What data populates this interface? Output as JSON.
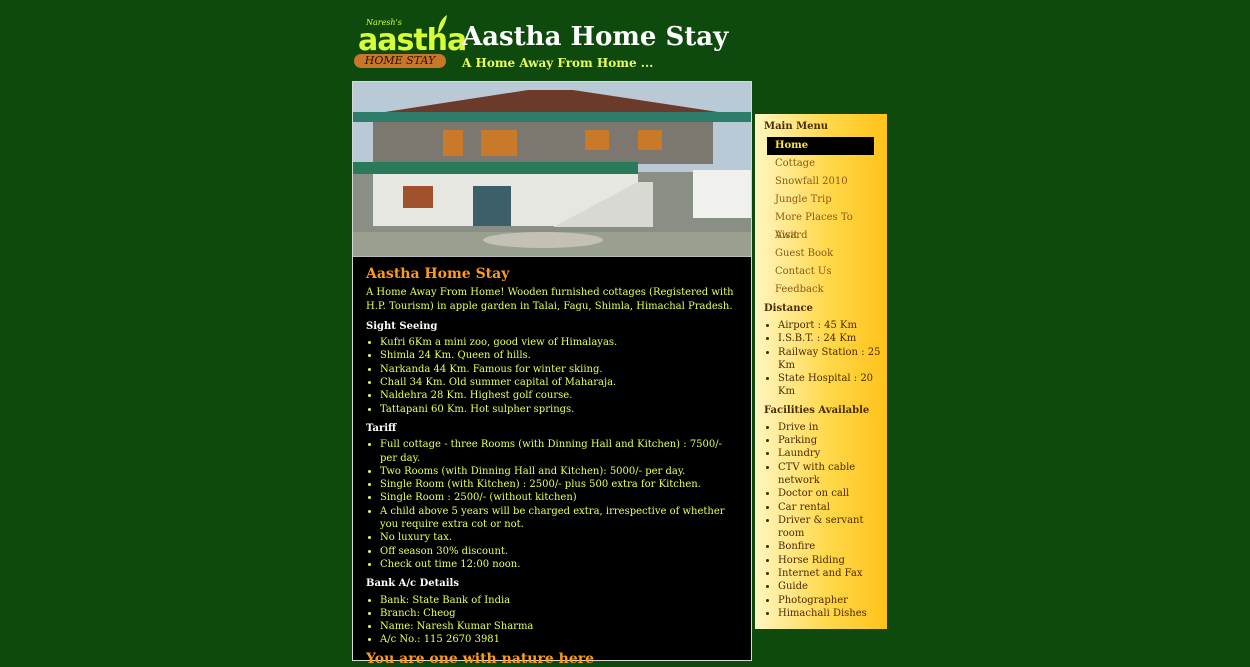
{
  "header": {
    "logo_small": "Naresh's",
    "logo_big": "aastha",
    "logo_band": "HOME STAY",
    "title": "Aastha Home Stay",
    "tagline": "A Home Away From Home ..."
  },
  "content": {
    "heading": "Aastha Home Stay",
    "intro": "A Home Away From Home! Wooden furnished cottages (Registered with H.P. Tourism) in apple garden in Talai, Fagu, Shimla, Himachal Pradesh.",
    "sight_title": "Sight Seeing",
    "sight": [
      "Kufri 6Km a mini zoo, good view of Himalayas.",
      "Shimla 24 Km. Queen of hills.",
      "Narkanda 44 Km. Famous for winter skiing.",
      "Chail 34 Km. Old summer capital of Maharaja.",
      "Naldehra 28 Km. Highest golf course.",
      "Tattapani 60 Km. Hot sulpher springs."
    ],
    "tariff_title": "Tariff",
    "tariff": [
      "Full cottage - three Rooms (with Dinning Hall and Kitchen) : 7500/- per day.",
      "Two Rooms (with Dinning Hall and Kitchen): 5000/- per day.",
      "Single Room (with Kitchen) : 2500/- plus 500 extra for Kitchen.",
      "Single Room : 2500/- (without kitchen)",
      "A child above 5 years will be charged extra, irrespective of whether you require extra cot or not.",
      "No luxury tax.",
      "Off season 30% discount.",
      "Check out time 12:00 noon."
    ],
    "bank_title": "Bank A/c Details",
    "bank": [
      "Bank: State Bank of India",
      "Branch: Cheog",
      "Name: Naresh Kumar Sharma",
      "A/c No.: 115 2670 3981"
    ],
    "closing": "You are one with nature here"
  },
  "sidebar": {
    "menu_title": "Main Menu",
    "menu": [
      "Home",
      "Cottage",
      "Snowfall 2010",
      "Jungle Trip",
      "More Places To Visit",
      "Award",
      "Guest Book",
      "Contact Us",
      "Feedback"
    ],
    "distance_title": "Distance",
    "distance": [
      "Airport : 45 Km",
      "I.S.B.T. : 24 Km",
      "Railway Station : 25 Km",
      "State Hospital : 20 Km"
    ],
    "facilities_title": "Facilities Available",
    "facilities": [
      "Drive in",
      "Parking",
      "Laundry",
      "CTV with cable network",
      "Doctor on call",
      "Car rental",
      "Driver & servant room",
      "Bonfire",
      "Horse Riding",
      "Internet and Fax",
      "Guide",
      "Photographer",
      "Himachali Dishes"
    ]
  },
  "colors": {
    "page_bg": "#0e4a0e",
    "heading_orange": "#ff9a1a",
    "text_yellow": "#e8ff5a",
    "sidebar_gold": "#ffc21a"
  }
}
